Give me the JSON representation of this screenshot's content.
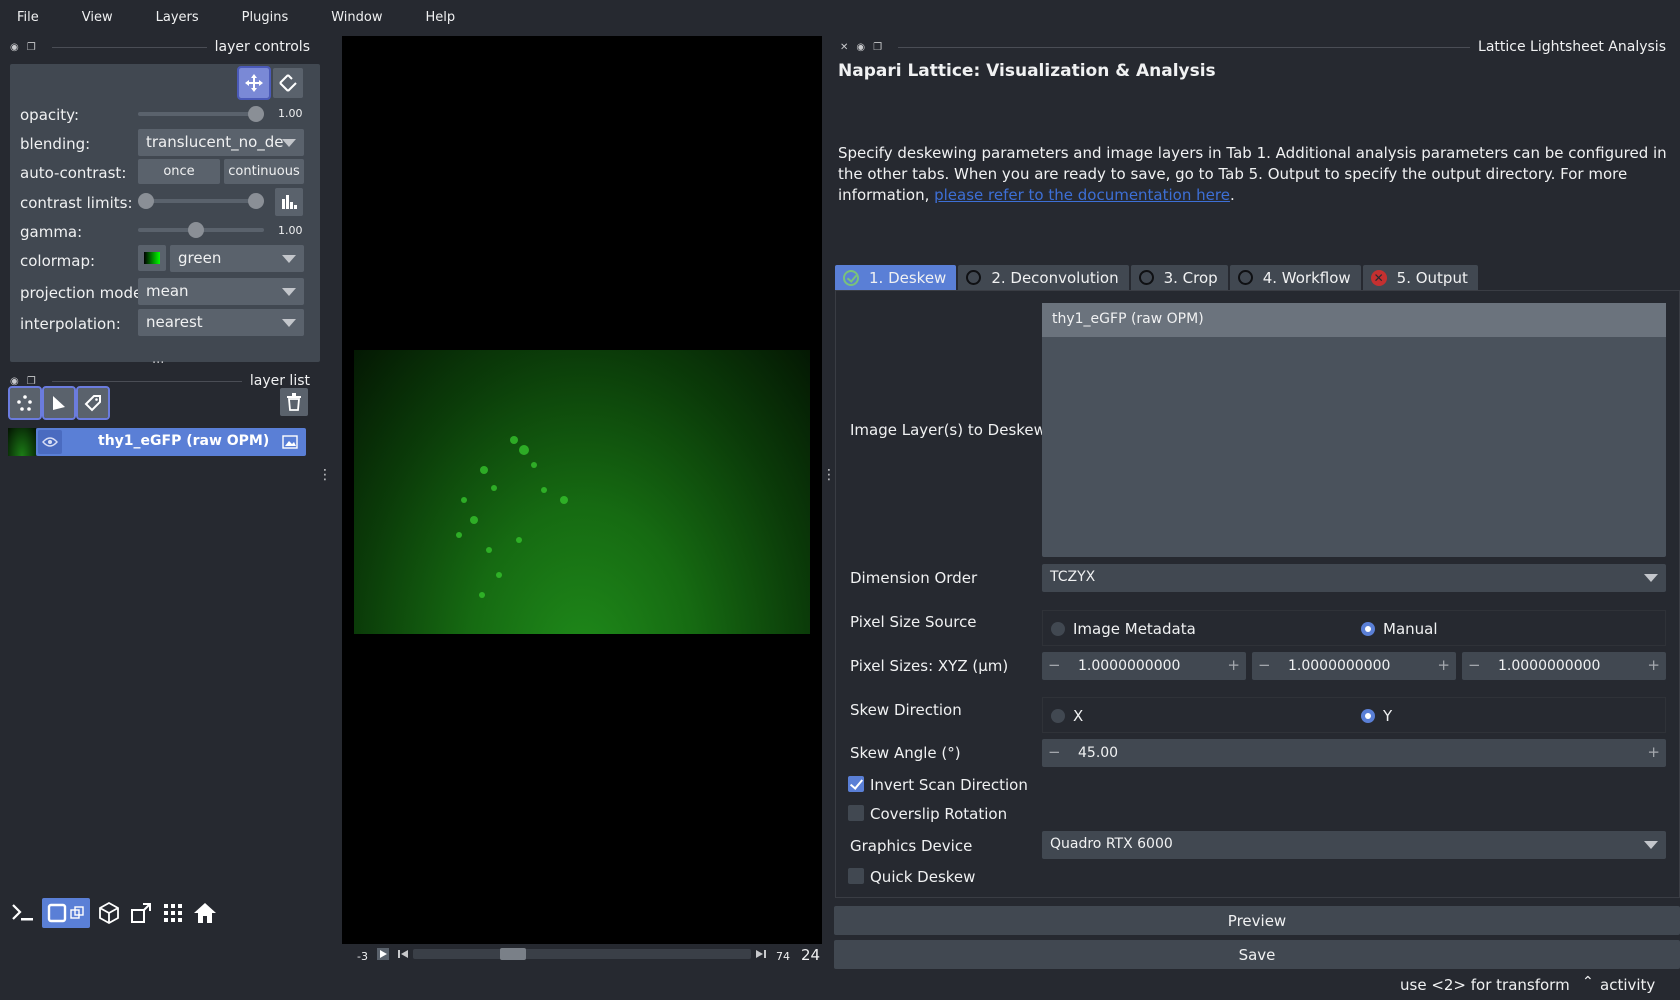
{
  "menu": {
    "items": [
      "File",
      "View",
      "Layers",
      "Plugins",
      "Window",
      "Help"
    ]
  },
  "layer_controls": {
    "title": "layer controls",
    "opacity_label": "opacity:",
    "opacity_value": "1.00",
    "opacity_level": 1.0,
    "blending_label": "blending:",
    "blending_value": "translucent_no_de",
    "auto_contrast_label": "auto-contrast:",
    "once_label": "once",
    "continuous_label": "continuous",
    "contrast_limits_label": "contrast limits:",
    "gamma_label": "gamma:",
    "gamma_value": "1.00",
    "gamma_level": 0.45,
    "colormap_label": "colormap:",
    "colormap_value": "green",
    "projection_label": "projection mode:",
    "projection_value": "mean",
    "interpolation_label": "interpolation:",
    "interpolation_value": "nearest",
    "ellipsis": "..."
  },
  "layer_list": {
    "title": "layer list",
    "layers": [
      {
        "name": "thy1_eGFP (raw OPM)"
      }
    ]
  },
  "dims": {
    "left_value": "-3",
    "right_value": "74",
    "current": "24",
    "slider_level": 0.28
  },
  "plugin": {
    "dock_title": "Lattice Lightsheet Analysis",
    "heading": "Napari Lattice: Visualization & Analysis",
    "description": "Specify deskewing parameters and image layers in Tab 1.  Additional analysis parameters can be configured in the other tabs.  When you are ready to save, go to Tab 5.  Output to specify the output directory.  For more information, ",
    "link_text": "please refer to the documentation here",
    "description_end": ".",
    "tabs": [
      {
        "label": "1. Deskew",
        "status": "ok"
      },
      {
        "label": "2. Deconvolution",
        "status": "none"
      },
      {
        "label": "3. Crop",
        "status": "none"
      },
      {
        "label": "4. Workflow",
        "status": "none"
      },
      {
        "label": "5. Output",
        "status": "error"
      }
    ],
    "image_layers_label": "Image Layer(s) to Deskew",
    "image_layers": [
      "thy1_eGFP (raw OPM)"
    ],
    "dimension_order_label": "Dimension Order",
    "dimension_order_value": "TCZYX",
    "pixel_size_source_label": "Pixel Size Source",
    "pixel_size_source_options": [
      "Image Metadata",
      "Manual"
    ],
    "pixel_size_source_selected": "Manual",
    "pixel_sizes_label": "Pixel Sizes: XYZ (µm)",
    "pixel_sizes": [
      "1.0000000000",
      "1.0000000000",
      "1.0000000000"
    ],
    "skew_direction_label": "Skew Direction",
    "skew_direction_options": [
      "X",
      "Y"
    ],
    "skew_direction_selected": "Y",
    "skew_angle_label": "Skew Angle (°)",
    "skew_angle_value": "45.00",
    "invert_scan_label": "Invert Scan Direction",
    "invert_scan_checked": true,
    "coverslip_label": "Coverslip Rotation",
    "coverslip_checked": false,
    "graphics_device_label": "Graphics Device",
    "graphics_device_value": "Quadro RTX 6000",
    "quick_deskew_label": "Quick Deskew",
    "quick_deskew_checked": false,
    "preview_label": "Preview",
    "save_label": "Save"
  },
  "status": {
    "hint": "use <2> for transform",
    "activity": "activity"
  },
  "colors": {
    "accent": "#5a7fd6",
    "panel": "#414851",
    "background": "#262930",
    "link": "#3d6fd6"
  }
}
